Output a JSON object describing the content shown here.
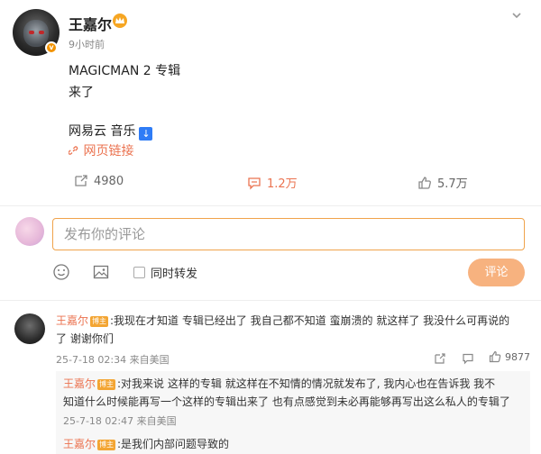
{
  "post": {
    "author": "王嘉尔",
    "time": "9小时前",
    "lines": [
      "MAGICMAN 2 专辑",
      "来了",
      "网易云 音乐"
    ],
    "music_arrow": "↓",
    "web_link": "网页链接",
    "reposts": "4980",
    "comments": "1.2万",
    "likes": "5.7万"
  },
  "composer": {
    "placeholder": "发布你的评论",
    "repost_label": "同时转发",
    "submit_label": "评论"
  },
  "comments": [
    {
      "author": "王嘉尔",
      "badge": "博主",
      "text_line1": ":我现在才知道 专辑已经出了 我自己都不知道 蛮崩溃的  就这样了 我没什么可再说的",
      "text_line2": "了  谢谢你们",
      "meta": "25-7-18 02:34 来自美国",
      "likes": "9877",
      "replies": [
        {
          "author": "王嘉尔",
          "badge": "博主",
          "text_line1": ":对我来说 这样的专辑 就这样在不知情的情况就发布了,   我内心也在告诉我 我不",
          "text_line2": "知道什么时候能再写一个这样的专辑出来了 也有点感觉到未必再能够再写出这么私人的专辑了",
          "meta": "25-7-18 02:47 来自美国"
        },
        {
          "author": "王嘉尔",
          "badge": "博主",
          "text_line1": ":是我们内部问题导致的"
        }
      ]
    }
  ],
  "colors": {
    "accent": "#eb7350",
    "link_blue": "#2f7cf6",
    "button_orange": "#f7b27f",
    "badge_orange": "#f29300"
  },
  "icons": {
    "repost": "repost-icon",
    "comment": "comment-icon",
    "like": "thumbs-up-icon",
    "emoji": "emoji-icon",
    "image": "image-icon",
    "link": "link-icon",
    "chevron": "chevron-down-icon"
  }
}
